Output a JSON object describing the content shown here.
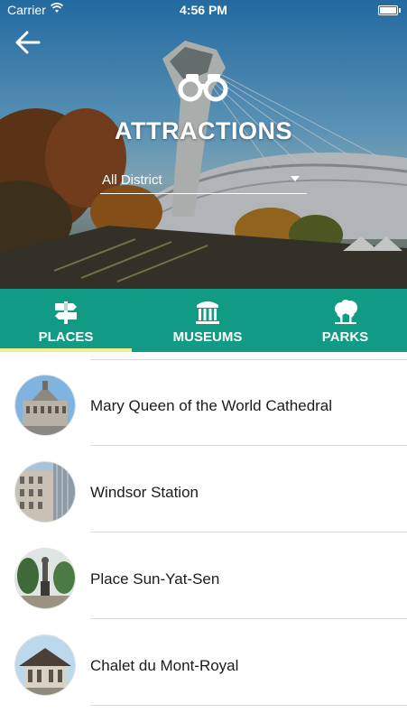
{
  "status_bar": {
    "carrier": "Carrier",
    "time": "4:56 PM"
  },
  "header": {
    "title": "ATTRACTIONS",
    "district_filter": {
      "selected": "All District"
    }
  },
  "tabs": [
    {
      "label": "PLACES",
      "icon": "signpost-icon",
      "active": true
    },
    {
      "label": "MUSEUMS",
      "icon": "museum-columns-icon",
      "active": false
    },
    {
      "label": "PARKS",
      "icon": "trees-icon",
      "active": false
    }
  ],
  "places": [
    {
      "name": "Mary Queen of the World Cathedral"
    },
    {
      "name": "Windsor Station"
    },
    {
      "name": "Place Sun-Yat-Sen"
    },
    {
      "name": "Chalet du Mont-Royal"
    }
  ],
  "colors": {
    "tab_bar": "#129b84",
    "active_indicator": "#f3ef8e",
    "text": "#1b1b1b",
    "divider": "#dcdcdc"
  }
}
